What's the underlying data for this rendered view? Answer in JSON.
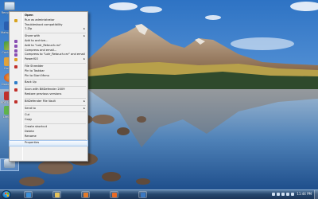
{
  "desktop": {
    "icons": [
      {
        "label": "Recycle Bin",
        "icon": "recycle-bin-icon"
      },
      {
        "label": "Malwa Fre Ant",
        "icon": "malware-icon"
      },
      {
        "label": "Cont Panel",
        "icon": "control-panel-icon"
      },
      {
        "label": "Downlo",
        "icon": "download-icon"
      },
      {
        "label": "Downl Firef",
        "icon": "firefox-icon"
      },
      {
        "label": "PDF Ma Desk",
        "icon": "pdf-icon"
      },
      {
        "label": "Limewire",
        "icon": "limewire-icon"
      }
    ]
  },
  "context_menu": {
    "items": [
      {
        "type": "item",
        "label": "Open",
        "default": true
      },
      {
        "type": "item",
        "label": "Run as administrator",
        "icon": "shield-icon",
        "icon_color": "#d8a31f"
      },
      {
        "type": "item",
        "label": "Troubleshoot compatibility"
      },
      {
        "type": "item",
        "label": "7-Zip",
        "submenu": true
      },
      {
        "type": "sep"
      },
      {
        "type": "item",
        "label": "Share with",
        "submenu": true
      },
      {
        "type": "item",
        "label": "Add to archive...",
        "icon": "archive-icon",
        "icon_color": "#8a4fb3"
      },
      {
        "type": "item",
        "label": "Add to \"Lotr_Retouch.rar\"",
        "icon": "archive-icon",
        "icon_color": "#8a4fb3"
      },
      {
        "type": "item",
        "label": "Compress and email...",
        "icon": "archive-icon",
        "icon_color": "#8a4fb3"
      },
      {
        "type": "item",
        "label": "Compress to \"Lotr_Retouch.rar\" and email",
        "icon": "archive-icon",
        "icon_color": "#8a4fb3"
      },
      {
        "type": "item",
        "label": "PowerISO",
        "icon": "poweriso-icon",
        "icon_color": "#e0a024",
        "submenu": true
      },
      {
        "type": "sep"
      },
      {
        "type": "item",
        "label": "File Shredder",
        "icon": "shredder-icon",
        "icon_color": "#c0302a"
      },
      {
        "type": "item",
        "label": "Pin to Taskbar"
      },
      {
        "type": "item",
        "label": "Pin to Start Menu"
      },
      {
        "type": "sep"
      },
      {
        "type": "item",
        "label": "Back Up",
        "icon": "backup-icon",
        "icon_color": "#2e7dc9"
      },
      {
        "type": "sep"
      },
      {
        "type": "item",
        "label": "Scan with BitDefender 2009",
        "icon": "bitdefender-icon",
        "icon_color": "#c0302a"
      },
      {
        "type": "item",
        "label": "Restore previous versions"
      },
      {
        "type": "sep"
      },
      {
        "type": "item",
        "label": "BitDefender File Vault",
        "icon": "vault-icon",
        "icon_color": "#c0302a",
        "submenu": true
      },
      {
        "type": "sep"
      },
      {
        "type": "item",
        "label": "Send to",
        "submenu": true
      },
      {
        "type": "sep"
      },
      {
        "type": "item",
        "label": "Cut"
      },
      {
        "type": "item",
        "label": "Copy"
      },
      {
        "type": "sep"
      },
      {
        "type": "item",
        "label": "Create shortcut"
      },
      {
        "type": "item",
        "label": "Delete"
      },
      {
        "type": "item",
        "label": "Rename"
      },
      {
        "type": "sep"
      },
      {
        "type": "item",
        "label": "Properties",
        "hover": true
      }
    ]
  },
  "taskbar": {
    "start_icon": "windows-logo-icon",
    "pinned": [
      {
        "name": "internet-explorer-icon",
        "color": "#3b8fd9"
      },
      {
        "name": "folder-icon",
        "color": "#e6c35a"
      },
      {
        "name": "media-player-icon",
        "color": "#e27a2a"
      },
      {
        "name": "firefox-icon",
        "color": "#e86a25"
      },
      {
        "name": "photoshop-icon",
        "color": "#3a78c2"
      }
    ],
    "tray_icons": [
      "flag-icon",
      "network-icon",
      "volume-icon",
      "battery-icon",
      "shield-icon"
    ],
    "clock": "11:44 PM"
  },
  "colors": {
    "sky": "#3f86d1",
    "mountain": "#8a6b4f",
    "forest": "#2f4a2c",
    "lake": "#3a6a9c",
    "menu_bg": "#f0f0f0",
    "taskbar": "#26476d"
  }
}
